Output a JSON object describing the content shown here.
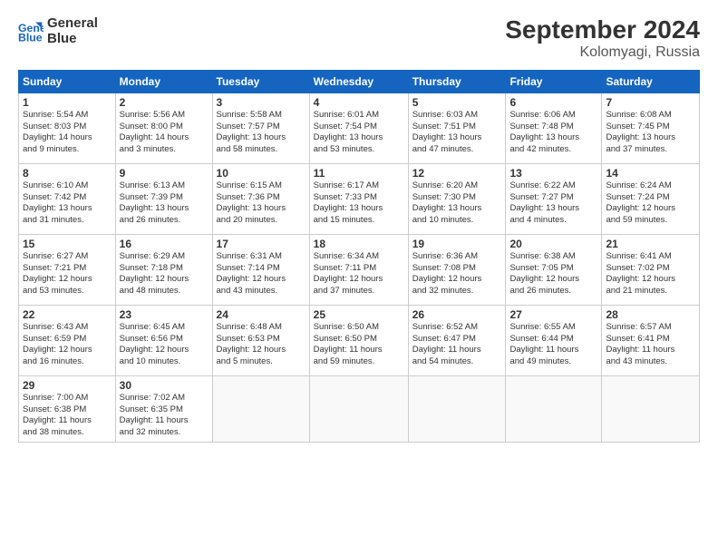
{
  "header": {
    "logo_line1": "General",
    "logo_line2": "Blue",
    "title": "September 2024",
    "subtitle": "Kolomyagi, Russia"
  },
  "weekdays": [
    "Sunday",
    "Monday",
    "Tuesday",
    "Wednesday",
    "Thursday",
    "Friday",
    "Saturday"
  ],
  "weeks": [
    [
      {
        "day": 1,
        "lines": [
          "Sunrise: 5:54 AM",
          "Sunset: 8:03 PM",
          "Daylight: 14 hours",
          "and 9 minutes."
        ]
      },
      {
        "day": 2,
        "lines": [
          "Sunrise: 5:56 AM",
          "Sunset: 8:00 PM",
          "Daylight: 14 hours",
          "and 3 minutes."
        ]
      },
      {
        "day": 3,
        "lines": [
          "Sunrise: 5:58 AM",
          "Sunset: 7:57 PM",
          "Daylight: 13 hours",
          "and 58 minutes."
        ]
      },
      {
        "day": 4,
        "lines": [
          "Sunrise: 6:01 AM",
          "Sunset: 7:54 PM",
          "Daylight: 13 hours",
          "and 53 minutes."
        ]
      },
      {
        "day": 5,
        "lines": [
          "Sunrise: 6:03 AM",
          "Sunset: 7:51 PM",
          "Daylight: 13 hours",
          "and 47 minutes."
        ]
      },
      {
        "day": 6,
        "lines": [
          "Sunrise: 6:06 AM",
          "Sunset: 7:48 PM",
          "Daylight: 13 hours",
          "and 42 minutes."
        ]
      },
      {
        "day": 7,
        "lines": [
          "Sunrise: 6:08 AM",
          "Sunset: 7:45 PM",
          "Daylight: 13 hours",
          "and 37 minutes."
        ]
      }
    ],
    [
      {
        "day": 8,
        "lines": [
          "Sunrise: 6:10 AM",
          "Sunset: 7:42 PM",
          "Daylight: 13 hours",
          "and 31 minutes."
        ]
      },
      {
        "day": 9,
        "lines": [
          "Sunrise: 6:13 AM",
          "Sunset: 7:39 PM",
          "Daylight: 13 hours",
          "and 26 minutes."
        ]
      },
      {
        "day": 10,
        "lines": [
          "Sunrise: 6:15 AM",
          "Sunset: 7:36 PM",
          "Daylight: 13 hours",
          "and 20 minutes."
        ]
      },
      {
        "day": 11,
        "lines": [
          "Sunrise: 6:17 AM",
          "Sunset: 7:33 PM",
          "Daylight: 13 hours",
          "and 15 minutes."
        ]
      },
      {
        "day": 12,
        "lines": [
          "Sunrise: 6:20 AM",
          "Sunset: 7:30 PM",
          "Daylight: 13 hours",
          "and 10 minutes."
        ]
      },
      {
        "day": 13,
        "lines": [
          "Sunrise: 6:22 AM",
          "Sunset: 7:27 PM",
          "Daylight: 13 hours",
          "and 4 minutes."
        ]
      },
      {
        "day": 14,
        "lines": [
          "Sunrise: 6:24 AM",
          "Sunset: 7:24 PM",
          "Daylight: 12 hours",
          "and 59 minutes."
        ]
      }
    ],
    [
      {
        "day": 15,
        "lines": [
          "Sunrise: 6:27 AM",
          "Sunset: 7:21 PM",
          "Daylight: 12 hours",
          "and 53 minutes."
        ]
      },
      {
        "day": 16,
        "lines": [
          "Sunrise: 6:29 AM",
          "Sunset: 7:18 PM",
          "Daylight: 12 hours",
          "and 48 minutes."
        ]
      },
      {
        "day": 17,
        "lines": [
          "Sunrise: 6:31 AM",
          "Sunset: 7:14 PM",
          "Daylight: 12 hours",
          "and 43 minutes."
        ]
      },
      {
        "day": 18,
        "lines": [
          "Sunrise: 6:34 AM",
          "Sunset: 7:11 PM",
          "Daylight: 12 hours",
          "and 37 minutes."
        ]
      },
      {
        "day": 19,
        "lines": [
          "Sunrise: 6:36 AM",
          "Sunset: 7:08 PM",
          "Daylight: 12 hours",
          "and 32 minutes."
        ]
      },
      {
        "day": 20,
        "lines": [
          "Sunrise: 6:38 AM",
          "Sunset: 7:05 PM",
          "Daylight: 12 hours",
          "and 26 minutes."
        ]
      },
      {
        "day": 21,
        "lines": [
          "Sunrise: 6:41 AM",
          "Sunset: 7:02 PM",
          "Daylight: 12 hours",
          "and 21 minutes."
        ]
      }
    ],
    [
      {
        "day": 22,
        "lines": [
          "Sunrise: 6:43 AM",
          "Sunset: 6:59 PM",
          "Daylight: 12 hours",
          "and 16 minutes."
        ]
      },
      {
        "day": 23,
        "lines": [
          "Sunrise: 6:45 AM",
          "Sunset: 6:56 PM",
          "Daylight: 12 hours",
          "and 10 minutes."
        ]
      },
      {
        "day": 24,
        "lines": [
          "Sunrise: 6:48 AM",
          "Sunset: 6:53 PM",
          "Daylight: 12 hours",
          "and 5 minutes."
        ]
      },
      {
        "day": 25,
        "lines": [
          "Sunrise: 6:50 AM",
          "Sunset: 6:50 PM",
          "Daylight: 11 hours",
          "and 59 minutes."
        ]
      },
      {
        "day": 26,
        "lines": [
          "Sunrise: 6:52 AM",
          "Sunset: 6:47 PM",
          "Daylight: 11 hours",
          "and 54 minutes."
        ]
      },
      {
        "day": 27,
        "lines": [
          "Sunrise: 6:55 AM",
          "Sunset: 6:44 PM",
          "Daylight: 11 hours",
          "and 49 minutes."
        ]
      },
      {
        "day": 28,
        "lines": [
          "Sunrise: 6:57 AM",
          "Sunset: 6:41 PM",
          "Daylight: 11 hours",
          "and 43 minutes."
        ]
      }
    ],
    [
      {
        "day": 29,
        "lines": [
          "Sunrise: 7:00 AM",
          "Sunset: 6:38 PM",
          "Daylight: 11 hours",
          "and 38 minutes."
        ]
      },
      {
        "day": 30,
        "lines": [
          "Sunrise: 7:02 AM",
          "Sunset: 6:35 PM",
          "Daylight: 11 hours",
          "and 32 minutes."
        ]
      },
      null,
      null,
      null,
      null,
      null
    ]
  ]
}
